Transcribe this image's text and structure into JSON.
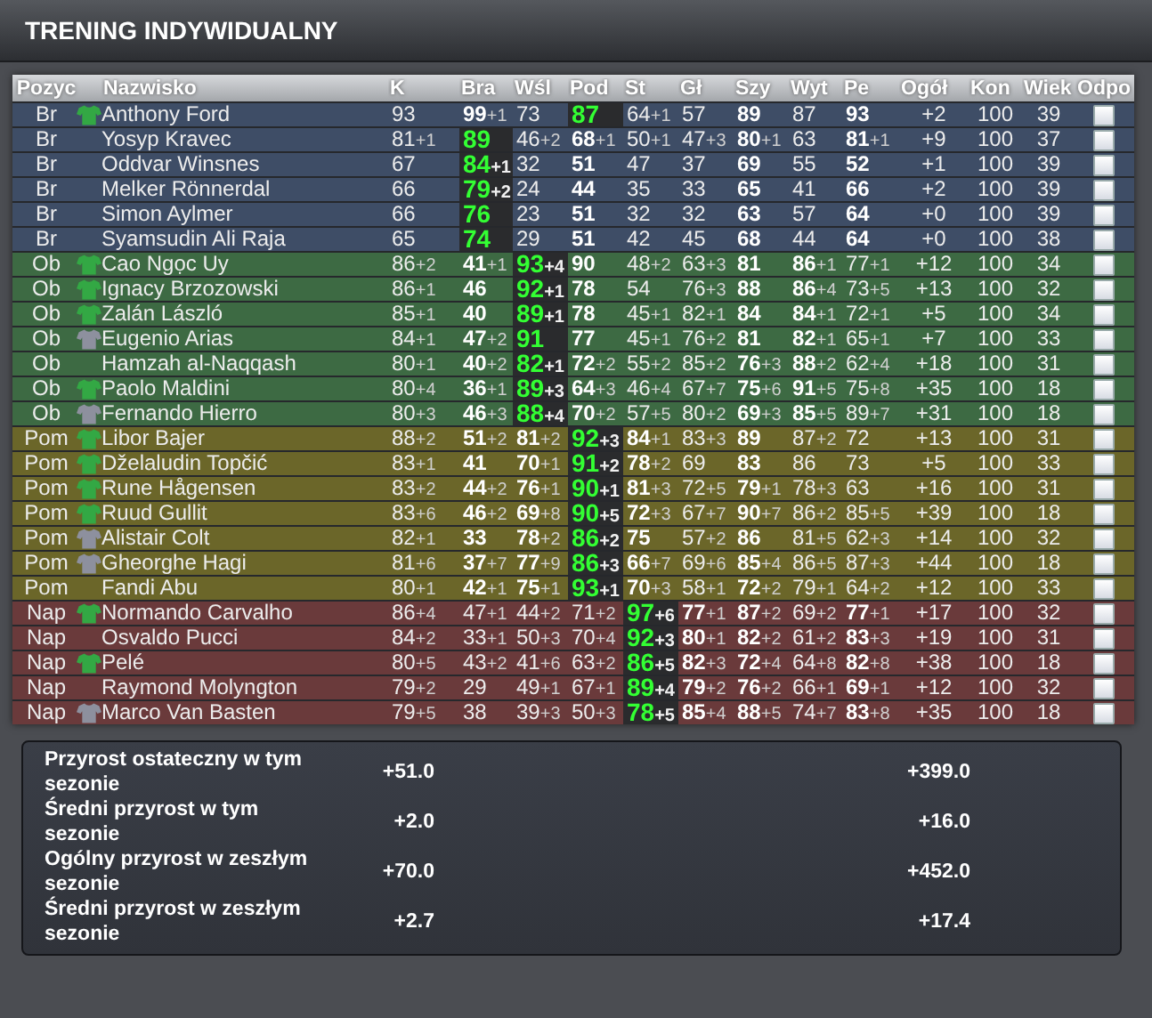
{
  "title": "TRENING INDYWIDUALNY",
  "columns": [
    "Pozyc",
    "Nazwisko",
    "K",
    "Bra",
    "Wśl",
    "Pod",
    "St",
    "Gł",
    "Szy",
    "Wyt",
    "Pe",
    "Ogół",
    "Kon",
    "Wiek",
    "Odpo"
  ],
  "groups": [
    {
      "color": "#3e4d66",
      "rows": [
        {
          "position": "Br",
          "color": "#33a844",
          "name": "Anthony Ford",
          "stats": [
            {
              "value": "93",
              "bold": false,
              "trained": false
            },
            {
              "value": "99",
              "gain": "+1",
              "bold": true,
              "trained": false
            },
            {
              "value": "73",
              "bold": false,
              "trained": false
            },
            {
              "value": "87",
              "bold": true,
              "trained": true
            },
            {
              "value": "64",
              "gain": "+1",
              "bold": false,
              "trained": false
            },
            {
              "value": "57",
              "bold": false,
              "trained": false
            },
            {
              "value": "89",
              "bold": true,
              "trained": false
            },
            {
              "value": "87",
              "bold": false,
              "trained": false
            },
            {
              "value": "93",
              "bold": true,
              "trained": false
            }
          ],
          "overall": "+2",
          "condition": "100",
          "age": "39",
          "checked": false
        },
        {
          "position": "Br",
          "name": "Yosyp Kravec",
          "stats": [
            {
              "value": "81",
              "gain": "+1",
              "bold": false,
              "trained": false
            },
            {
              "value": "89",
              "bold": true,
              "trained": true
            },
            {
              "value": "46",
              "gain": "+2",
              "bold": false,
              "trained": false
            },
            {
              "value": "68",
              "gain": "+1",
              "bold": true,
              "trained": false
            },
            {
              "value": "50",
              "gain": "+1",
              "bold": false,
              "trained": false
            },
            {
              "value": "47",
              "gain": "+3",
              "bold": false,
              "trained": false
            },
            {
              "value": "80",
              "gain": "+1",
              "bold": true,
              "trained": false
            },
            {
              "value": "63",
              "bold": false,
              "trained": false
            },
            {
              "value": "81",
              "gain": "+1",
              "bold": true,
              "trained": false
            }
          ],
          "overall": "+9",
          "condition": "100",
          "age": "37",
          "checked": false
        },
        {
          "position": "Br",
          "name": "Oddvar Winsnes",
          "stats": [
            {
              "value": "67",
              "bold": false,
              "trained": false
            },
            {
              "value": "84",
              "gain": "+1",
              "bold": true,
              "trained": true
            },
            {
              "value": "32",
              "bold": false,
              "trained": false
            },
            {
              "value": "51",
              "bold": true,
              "trained": false
            },
            {
              "value": "47",
              "bold": false,
              "trained": false
            },
            {
              "value": "37",
              "bold": false,
              "trained": false
            },
            {
              "value": "69",
              "bold": true,
              "trained": false
            },
            {
              "value": "55",
              "bold": false,
              "trained": false
            },
            {
              "value": "52",
              "bold": true,
              "trained": false
            }
          ],
          "overall": "+1",
          "condition": "100",
          "age": "39",
          "checked": false
        },
        {
          "position": "Br",
          "name": "Melker Rönnerdal",
          "stats": [
            {
              "value": "66",
              "bold": false,
              "trained": false
            },
            {
              "value": "79",
              "gain": "+2",
              "bold": true,
              "trained": true
            },
            {
              "value": "24",
              "bold": false,
              "trained": false
            },
            {
              "value": "44",
              "bold": true,
              "trained": false
            },
            {
              "value": "35",
              "bold": false,
              "trained": false
            },
            {
              "value": "33",
              "bold": false,
              "trained": false
            },
            {
              "value": "65",
              "bold": true,
              "trained": false
            },
            {
              "value": "41",
              "bold": false,
              "trained": false
            },
            {
              "value": "66",
              "bold": true,
              "trained": false
            }
          ],
          "overall": "+2",
          "condition": "100",
          "age": "39",
          "checked": false
        },
        {
          "position": "Br",
          "name": "Simon Aylmer",
          "stats": [
            {
              "value": "66",
              "bold": false,
              "trained": false
            },
            {
              "value": "76",
              "bold": true,
              "trained": true
            },
            {
              "value": "23",
              "bold": false,
              "trained": false
            },
            {
              "value": "51",
              "bold": true,
              "trained": false
            },
            {
              "value": "32",
              "bold": false,
              "trained": false
            },
            {
              "value": "32",
              "bold": false,
              "trained": false
            },
            {
              "value": "63",
              "bold": true,
              "trained": false
            },
            {
              "value": "57",
              "bold": false,
              "trained": false
            },
            {
              "value": "64",
              "bold": true,
              "trained": false
            }
          ],
          "overall": "+0",
          "condition": "100",
          "age": "39",
          "checked": false
        },
        {
          "position": "Br",
          "name": "Syamsudin Ali Raja",
          "stats": [
            {
              "value": "65",
              "bold": false,
              "trained": false
            },
            {
              "value": "74",
              "bold": true,
              "trained": true
            },
            {
              "value": "29",
              "bold": false,
              "trained": false
            },
            {
              "value": "51",
              "bold": true,
              "trained": false
            },
            {
              "value": "42",
              "bold": false,
              "trained": false
            },
            {
              "value": "45",
              "bold": false,
              "trained": false
            },
            {
              "value": "68",
              "bold": true,
              "trained": false
            },
            {
              "value": "44",
              "bold": false,
              "trained": false
            },
            {
              "value": "64",
              "bold": true,
              "trained": false
            }
          ],
          "overall": "+0",
          "condition": "100",
          "age": "38",
          "checked": false
        }
      ]
    },
    {
      "color": "#3d6a43",
      "rows": [
        {
          "position": "Ob",
          "color": "#33a844",
          "name": "Cao Ngọc Uy",
          "stats": [
            {
              "value": "86",
              "gain": "+2",
              "bold": false,
              "trained": false
            },
            {
              "value": "41",
              "gain": "+1",
              "bold": true,
              "trained": false
            },
            {
              "value": "93",
              "gain": "+4",
              "bold": true,
              "trained": true
            },
            {
              "value": "90",
              "bold": true,
              "trained": false
            },
            {
              "value": "48",
              "gain": "+2",
              "bold": false,
              "trained": false
            },
            {
              "value": "63",
              "gain": "+3",
              "bold": false,
              "trained": false
            },
            {
              "value": "81",
              "bold": true,
              "trained": false
            },
            {
              "value": "86",
              "gain": "+1",
              "bold": true,
              "trained": false
            },
            {
              "value": "77",
              "gain": "+1",
              "bold": false,
              "trained": false
            }
          ],
          "overall": "+12",
          "condition": "100",
          "age": "34",
          "checked": false
        },
        {
          "position": "Ob",
          "color": "#33a844",
          "name": "Ignacy Brzozowski",
          "stats": [
            {
              "value": "86",
              "gain": "+1",
              "bold": false,
              "trained": false
            },
            {
              "value": "46",
              "bold": true,
              "trained": false
            },
            {
              "value": "92",
              "gain": "+1",
              "bold": true,
              "trained": true
            },
            {
              "value": "78",
              "bold": true,
              "trained": false
            },
            {
              "value": "54",
              "bold": false,
              "trained": false
            },
            {
              "value": "76",
              "gain": "+3",
              "bold": false,
              "trained": false
            },
            {
              "value": "88",
              "bold": true,
              "trained": false
            },
            {
              "value": "86",
              "gain": "+4",
              "bold": true,
              "trained": false
            },
            {
              "value": "73",
              "gain": "+5",
              "bold": false,
              "trained": false
            }
          ],
          "overall": "+13",
          "condition": "100",
          "age": "32",
          "checked": false
        },
        {
          "position": "Ob",
          "color": "#33a844",
          "name": "Zalán László",
          "stats": [
            {
              "value": "85",
              "gain": "+1",
              "bold": false,
              "trained": false
            },
            {
              "value": "40",
              "bold": true,
              "trained": false
            },
            {
              "value": "89",
              "gain": "+1",
              "bold": true,
              "trained": true
            },
            {
              "value": "78",
              "bold": true,
              "trained": false
            },
            {
              "value": "45",
              "gain": "+1",
              "bold": false,
              "trained": false
            },
            {
              "value": "82",
              "gain": "+1",
              "bold": false,
              "trained": false
            },
            {
              "value": "84",
              "bold": true,
              "trained": false
            },
            {
              "value": "84",
              "gain": "+1",
              "bold": true,
              "trained": false
            },
            {
              "value": "72",
              "gain": "+1",
              "bold": false,
              "trained": false
            }
          ],
          "overall": "+5",
          "condition": "100",
          "age": "34",
          "checked": false
        },
        {
          "position": "Ob",
          "color": "#8d909e",
          "name": "Eugenio Arias",
          "stats": [
            {
              "value": "84",
              "gain": "+1",
              "bold": false,
              "trained": false
            },
            {
              "value": "47",
              "gain": "+2",
              "bold": true,
              "trained": false
            },
            {
              "value": "91",
              "bold": true,
              "trained": true
            },
            {
              "value": "77",
              "bold": true,
              "trained": false
            },
            {
              "value": "45",
              "gain": "+1",
              "bold": false,
              "trained": false
            },
            {
              "value": "76",
              "gain": "+2",
              "bold": false,
              "trained": false
            },
            {
              "value": "81",
              "bold": true,
              "trained": false
            },
            {
              "value": "82",
              "gain": "+1",
              "bold": true,
              "trained": false
            },
            {
              "value": "65",
              "gain": "+1",
              "bold": false,
              "trained": false
            }
          ],
          "overall": "+7",
          "condition": "100",
          "age": "33",
          "checked": false
        },
        {
          "position": "Ob",
          "name": "Hamzah al-Naqqash",
          "stats": [
            {
              "value": "80",
              "gain": "+1",
              "bold": false,
              "trained": false
            },
            {
              "value": "40",
              "gain": "+2",
              "bold": true,
              "trained": false
            },
            {
              "value": "82",
              "gain": "+1",
              "bold": true,
              "trained": true
            },
            {
              "value": "72",
              "gain": "+2",
              "bold": true,
              "trained": false
            },
            {
              "value": "55",
              "gain": "+2",
              "bold": false,
              "trained": false
            },
            {
              "value": "85",
              "gain": "+2",
              "bold": false,
              "trained": false
            },
            {
              "value": "76",
              "gain": "+3",
              "bold": true,
              "trained": false
            },
            {
              "value": "88",
              "gain": "+2",
              "bold": true,
              "trained": false
            },
            {
              "value": "62",
              "gain": "+4",
              "bold": false,
              "trained": false
            }
          ],
          "overall": "+18",
          "condition": "100",
          "age": "31",
          "checked": false
        },
        {
          "position": "Ob",
          "color": "#33a844",
          "name": "Paolo Maldini",
          "stats": [
            {
              "value": "80",
              "gain": "+4",
              "bold": false,
              "trained": false
            },
            {
              "value": "36",
              "gain": "+1",
              "bold": true,
              "trained": false
            },
            {
              "value": "89",
              "gain": "+3",
              "bold": true,
              "trained": true
            },
            {
              "value": "64",
              "gain": "+3",
              "bold": true,
              "trained": false
            },
            {
              "value": "46",
              "gain": "+4",
              "bold": false,
              "trained": false
            },
            {
              "value": "67",
              "gain": "+7",
              "bold": false,
              "trained": false
            },
            {
              "value": "75",
              "gain": "+6",
              "bold": true,
              "trained": false
            },
            {
              "value": "91",
              "gain": "+5",
              "bold": true,
              "trained": false
            },
            {
              "value": "75",
              "gain": "+8",
              "bold": false,
              "trained": false
            }
          ],
          "overall": "+35",
          "condition": "100",
          "age": "18",
          "checked": false
        },
        {
          "position": "Ob",
          "color": "#8d909e",
          "name": "Fernando Hierro",
          "stats": [
            {
              "value": "80",
              "gain": "+3",
              "bold": false,
              "trained": false
            },
            {
              "value": "46",
              "gain": "+3",
              "bold": true,
              "trained": false
            },
            {
              "value": "88",
              "gain": "+4",
              "bold": true,
              "trained": true
            },
            {
              "value": "70",
              "gain": "+2",
              "bold": true,
              "trained": false
            },
            {
              "value": "57",
              "gain": "+5",
              "bold": false,
              "trained": false
            },
            {
              "value": "80",
              "gain": "+2",
              "bold": false,
              "trained": false
            },
            {
              "value": "69",
              "gain": "+3",
              "bold": true,
              "trained": false
            },
            {
              "value": "85",
              "gain": "+5",
              "bold": true,
              "trained": false
            },
            {
              "value": "89",
              "gain": "+7",
              "bold": false,
              "trained": false
            }
          ],
          "overall": "+31",
          "condition": "100",
          "age": "18",
          "checked": false
        }
      ]
    },
    {
      "color": "#6b6629",
      "rows": [
        {
          "position": "Pom",
          "color": "#33a844",
          "name": "Libor Bajer",
          "stats": [
            {
              "value": "88",
              "gain": "+2",
              "bold": false,
              "trained": false
            },
            {
              "value": "51",
              "gain": "+2",
              "bold": true,
              "trained": false
            },
            {
              "value": "81",
              "gain": "+2",
              "bold": true,
              "trained": false
            },
            {
              "value": "92",
              "gain": "+3",
              "bold": true,
              "trained": true
            },
            {
              "value": "84",
              "gain": "+1",
              "bold": true,
              "trained": false
            },
            {
              "value": "83",
              "gain": "+3",
              "bold": false,
              "trained": false
            },
            {
              "value": "89",
              "bold": true,
              "trained": false
            },
            {
              "value": "87",
              "gain": "+2",
              "bold": false,
              "trained": false
            },
            {
              "value": "72",
              "bold": false,
              "trained": false
            }
          ],
          "overall": "+13",
          "condition": "100",
          "age": "31",
          "checked": false
        },
        {
          "position": "Pom",
          "color": "#33a844",
          "name": "Dželaludin Topčić",
          "stats": [
            {
              "value": "83",
              "gain": "+1",
              "bold": false,
              "trained": false
            },
            {
              "value": "41",
              "bold": true,
              "trained": false
            },
            {
              "value": "70",
              "gain": "+1",
              "bold": true,
              "trained": false
            },
            {
              "value": "91",
              "gain": "+2",
              "bold": true,
              "trained": true
            },
            {
              "value": "78",
              "gain": "+2",
              "bold": true,
              "trained": false
            },
            {
              "value": "69",
              "bold": false,
              "trained": false
            },
            {
              "value": "83",
              "bold": true,
              "trained": false
            },
            {
              "value": "86",
              "bold": false,
              "trained": false
            },
            {
              "value": "73",
              "bold": false,
              "trained": false
            }
          ],
          "overall": "+5",
          "condition": "100",
          "age": "33",
          "checked": false
        },
        {
          "position": "Pom",
          "color": "#33a844",
          "name": "Rune Hågensen",
          "stats": [
            {
              "value": "83",
              "gain": "+2",
              "bold": false,
              "trained": false
            },
            {
              "value": "44",
              "gain": "+2",
              "bold": true,
              "trained": false
            },
            {
              "value": "76",
              "gain": "+1",
              "bold": true,
              "trained": false
            },
            {
              "value": "90",
              "gain": "+1",
              "bold": true,
              "trained": true
            },
            {
              "value": "81",
              "gain": "+3",
              "bold": true,
              "trained": false
            },
            {
              "value": "72",
              "gain": "+5",
              "bold": false,
              "trained": false
            },
            {
              "value": "79",
              "gain": "+1",
              "bold": true,
              "trained": false
            },
            {
              "value": "78",
              "gain": "+3",
              "bold": false,
              "trained": false
            },
            {
              "value": "63",
              "bold": false,
              "trained": false
            }
          ],
          "overall": "+16",
          "condition": "100",
          "age": "31",
          "checked": false
        },
        {
          "position": "Pom",
          "color": "#33a844",
          "name": "Ruud Gullit",
          "stats": [
            {
              "value": "83",
              "gain": "+6",
              "bold": false,
              "trained": false
            },
            {
              "value": "46",
              "gain": "+2",
              "bold": true,
              "trained": false
            },
            {
              "value": "69",
              "gain": "+8",
              "bold": true,
              "trained": false
            },
            {
              "value": "90",
              "gain": "+5",
              "bold": true,
              "trained": true
            },
            {
              "value": "72",
              "gain": "+3",
              "bold": true,
              "trained": false
            },
            {
              "value": "67",
              "gain": "+7",
              "bold": false,
              "trained": false
            },
            {
              "value": "90",
              "gain": "+7",
              "bold": true,
              "trained": false
            },
            {
              "value": "86",
              "gain": "+2",
              "bold": false,
              "trained": false
            },
            {
              "value": "85",
              "gain": "+5",
              "bold": false,
              "trained": false
            }
          ],
          "overall": "+39",
          "condition": "100",
          "age": "18",
          "checked": false
        },
        {
          "position": "Pom",
          "color": "#8d909e",
          "name": "Alistair Colt",
          "stats": [
            {
              "value": "82",
              "gain": "+1",
              "bold": false,
              "trained": false
            },
            {
              "value": "33",
              "bold": true,
              "trained": false
            },
            {
              "value": "78",
              "gain": "+2",
              "bold": true,
              "trained": false
            },
            {
              "value": "86",
              "gain": "+2",
              "bold": true,
              "trained": true
            },
            {
              "value": "75",
              "bold": true,
              "trained": false
            },
            {
              "value": "57",
              "gain": "+2",
              "bold": false,
              "trained": false
            },
            {
              "value": "86",
              "bold": true,
              "trained": false
            },
            {
              "value": "81",
              "gain": "+5",
              "bold": false,
              "trained": false
            },
            {
              "value": "62",
              "gain": "+3",
              "bold": false,
              "trained": false
            }
          ],
          "overall": "+14",
          "condition": "100",
          "age": "32",
          "checked": false
        },
        {
          "position": "Pom",
          "color": "#8d909e",
          "name": "Gheorghe Hagi",
          "stats": [
            {
              "value": "81",
              "gain": "+6",
              "bold": false,
              "trained": false
            },
            {
              "value": "37",
              "gain": "+7",
              "bold": true,
              "trained": false
            },
            {
              "value": "77",
              "gain": "+9",
              "bold": true,
              "trained": false
            },
            {
              "value": "86",
              "gain": "+3",
              "bold": true,
              "trained": true
            },
            {
              "value": "66",
              "gain": "+7",
              "bold": true,
              "trained": false
            },
            {
              "value": "69",
              "gain": "+6",
              "bold": false,
              "trained": false
            },
            {
              "value": "85",
              "gain": "+4",
              "bold": true,
              "trained": false
            },
            {
              "value": "86",
              "gain": "+5",
              "bold": false,
              "trained": false
            },
            {
              "value": "87",
              "gain": "+3",
              "bold": false,
              "trained": false
            }
          ],
          "overall": "+44",
          "condition": "100",
          "age": "18",
          "checked": false
        },
        {
          "position": "Pom",
          "name": "Fandi Abu",
          "stats": [
            {
              "value": "80",
              "gain": "+1",
              "bold": false,
              "trained": false
            },
            {
              "value": "42",
              "gain": "+1",
              "bold": true,
              "trained": false
            },
            {
              "value": "75",
              "gain": "+1",
              "bold": true,
              "trained": false
            },
            {
              "value": "93",
              "gain": "+1",
              "bold": true,
              "trained": true
            },
            {
              "value": "70",
              "gain": "+3",
              "bold": true,
              "trained": false
            },
            {
              "value": "58",
              "gain": "+1",
              "bold": false,
              "trained": false
            },
            {
              "value": "72",
              "gain": "+2",
              "bold": true,
              "trained": false
            },
            {
              "value": "79",
              "gain": "+1",
              "bold": false,
              "trained": false
            },
            {
              "value": "64",
              "gain": "+2",
              "bold": false,
              "trained": false
            }
          ],
          "overall": "+12",
          "condition": "100",
          "age": "33",
          "checked": false
        }
      ]
    },
    {
      "color": "#6a3a3b",
      "rows": [
        {
          "position": "Nap",
          "color": "#33a844",
          "name": "Normando Carvalho",
          "stats": [
            {
              "value": "86",
              "gain": "+4",
              "bold": false,
              "trained": false
            },
            {
              "value": "47",
              "gain": "+1",
              "bold": false,
              "trained": false
            },
            {
              "value": "44",
              "gain": "+2",
              "bold": false,
              "trained": false
            },
            {
              "value": "71",
              "gain": "+2",
              "bold": false,
              "trained": false
            },
            {
              "value": "97",
              "gain": "+6",
              "bold": true,
              "trained": true
            },
            {
              "value": "77",
              "gain": "+1",
              "bold": true,
              "trained": false
            },
            {
              "value": "87",
              "gain": "+2",
              "bold": true,
              "trained": false
            },
            {
              "value": "69",
              "gain": "+2",
              "bold": false,
              "trained": false
            },
            {
              "value": "77",
              "gain": "+1",
              "bold": true,
              "trained": false
            }
          ],
          "overall": "+17",
          "condition": "100",
          "age": "32",
          "checked": false
        },
        {
          "position": "Nap",
          "name": "Osvaldo Pucci",
          "stats": [
            {
              "value": "84",
              "gain": "+2",
              "bold": false,
              "trained": false
            },
            {
              "value": "33",
              "gain": "+1",
              "bold": false,
              "trained": false
            },
            {
              "value": "50",
              "gain": "+3",
              "bold": false,
              "trained": false
            },
            {
              "value": "70",
              "gain": "+4",
              "bold": false,
              "trained": false
            },
            {
              "value": "92",
              "gain": "+3",
              "bold": true,
              "trained": true
            },
            {
              "value": "80",
              "gain": "+1",
              "bold": true,
              "trained": false
            },
            {
              "value": "82",
              "gain": "+2",
              "bold": true,
              "trained": false
            },
            {
              "value": "61",
              "gain": "+2",
              "bold": false,
              "trained": false
            },
            {
              "value": "83",
              "gain": "+3",
              "bold": true,
              "trained": false
            }
          ],
          "overall": "+19",
          "condition": "100",
          "age": "31",
          "checked": false
        },
        {
          "position": "Nap",
          "color": "#33a844",
          "name": "Pelé",
          "stats": [
            {
              "value": "80",
              "gain": "+5",
              "bold": false,
              "trained": false
            },
            {
              "value": "43",
              "gain": "+2",
              "bold": false,
              "trained": false
            },
            {
              "value": "41",
              "gain": "+6",
              "bold": false,
              "trained": false
            },
            {
              "value": "63",
              "gain": "+2",
              "bold": false,
              "trained": false
            },
            {
              "value": "86",
              "gain": "+5",
              "bold": true,
              "trained": true
            },
            {
              "value": "82",
              "gain": "+3",
              "bold": true,
              "trained": false
            },
            {
              "value": "72",
              "gain": "+4",
              "bold": true,
              "trained": false
            },
            {
              "value": "64",
              "gain": "+8",
              "bold": false,
              "trained": false
            },
            {
              "value": "82",
              "gain": "+8",
              "bold": true,
              "trained": false
            }
          ],
          "overall": "+38",
          "condition": "100",
          "age": "18",
          "checked": false
        },
        {
          "position": "Nap",
          "name": "Raymond Molyngton",
          "stats": [
            {
              "value": "79",
              "gain": "+2",
              "bold": false,
              "trained": false
            },
            {
              "value": "29",
              "bold": false,
              "trained": false
            },
            {
              "value": "49",
              "gain": "+1",
              "bold": false,
              "trained": false
            },
            {
              "value": "67",
              "gain": "+1",
              "bold": false,
              "trained": false
            },
            {
              "value": "89",
              "gain": "+4",
              "bold": true,
              "trained": true
            },
            {
              "value": "79",
              "gain": "+2",
              "bold": true,
              "trained": false
            },
            {
              "value": "76",
              "gain": "+2",
              "bold": true,
              "trained": false
            },
            {
              "value": "66",
              "gain": "+1",
              "bold": false,
              "trained": false
            },
            {
              "value": "69",
              "gain": "+1",
              "bold": true,
              "trained": false
            }
          ],
          "overall": "+12",
          "condition": "100",
          "age": "32",
          "checked": false
        },
        {
          "position": "Nap",
          "color": "#8d909e",
          "name": "Marco Van Basten",
          "stats": [
            {
              "value": "79",
              "gain": "+5",
              "bold": false,
              "trained": false
            },
            {
              "value": "38",
              "bold": false,
              "trained": false
            },
            {
              "value": "39",
              "gain": "+3",
              "bold": false,
              "trained": false
            },
            {
              "value": "50",
              "gain": "+3",
              "bold": false,
              "trained": false
            },
            {
              "value": "78",
              "gain": "+5",
              "bold": true,
              "trained": true
            },
            {
              "value": "85",
              "gain": "+4",
              "bold": true,
              "trained": false
            },
            {
              "value": "88",
              "gain": "+5",
              "bold": true,
              "trained": false
            },
            {
              "value": "74",
              "gain": "+7",
              "bold": false,
              "trained": false
            },
            {
              "value": "83",
              "gain": "+8",
              "bold": true,
              "trained": false
            }
          ],
          "overall": "+35",
          "condition": "100",
          "age": "18",
          "checked": false
        }
      ]
    }
  ],
  "summary": [
    {
      "label": "Przyrost ostateczny w tym sezonie",
      "value_1": "+51.0",
      "value_2": "+399.0"
    },
    {
      "label": "Średni przyrost w tym sezonie",
      "value_1": "+2.0",
      "value_2": "+16.0"
    },
    {
      "label": "Ogólny przyrost w zeszłym sezonie",
      "value_1": "+70.0",
      "value_2": "+452.0"
    },
    {
      "label": "Średni przyrost w zeszłym sezonie",
      "value_1": "+2.7",
      "value_2": "+17.4"
    }
  ]
}
